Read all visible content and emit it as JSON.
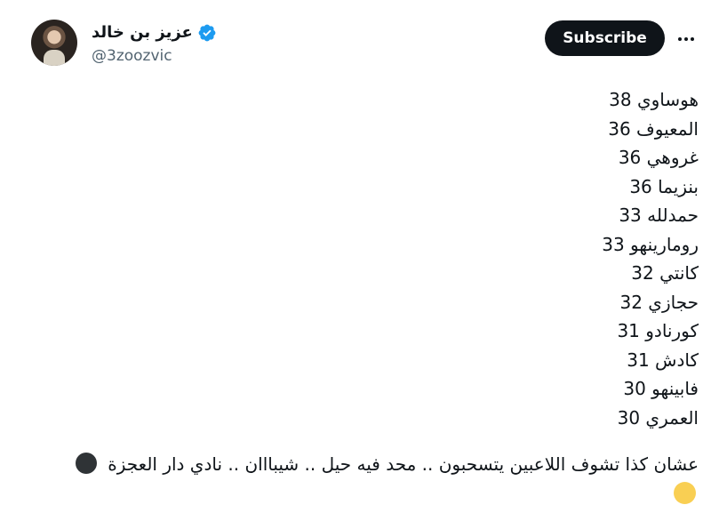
{
  "author": {
    "display_name": "عزيز بن خالد",
    "handle": "@3zoozvic",
    "verified": true,
    "verified_color": "#1d9bf0"
  },
  "actions": {
    "subscribe_label": "Subscribe",
    "more_icon": "more-horizontal-icon"
  },
  "tweet": {
    "lines": [
      "هوساوي 38",
      "المعيوف 36",
      "غروهي 36",
      "بنزيما 36",
      "حمدلله 33",
      "رومارينهو 33",
      "كانتي 32",
      "حجازي 32",
      "كورنادو 31",
      "كادش 31",
      "فابينهو 30",
      "العمري 30"
    ],
    "closing_text": "عشان كذا تشوف اللاعبين يتسحبون .. محد فيه حيل .. شيبااان .. نادي دار العجزة",
    "emoji_dark": "dark-circle-emoji",
    "emoji_light": "yellow-circle-emoji"
  }
}
